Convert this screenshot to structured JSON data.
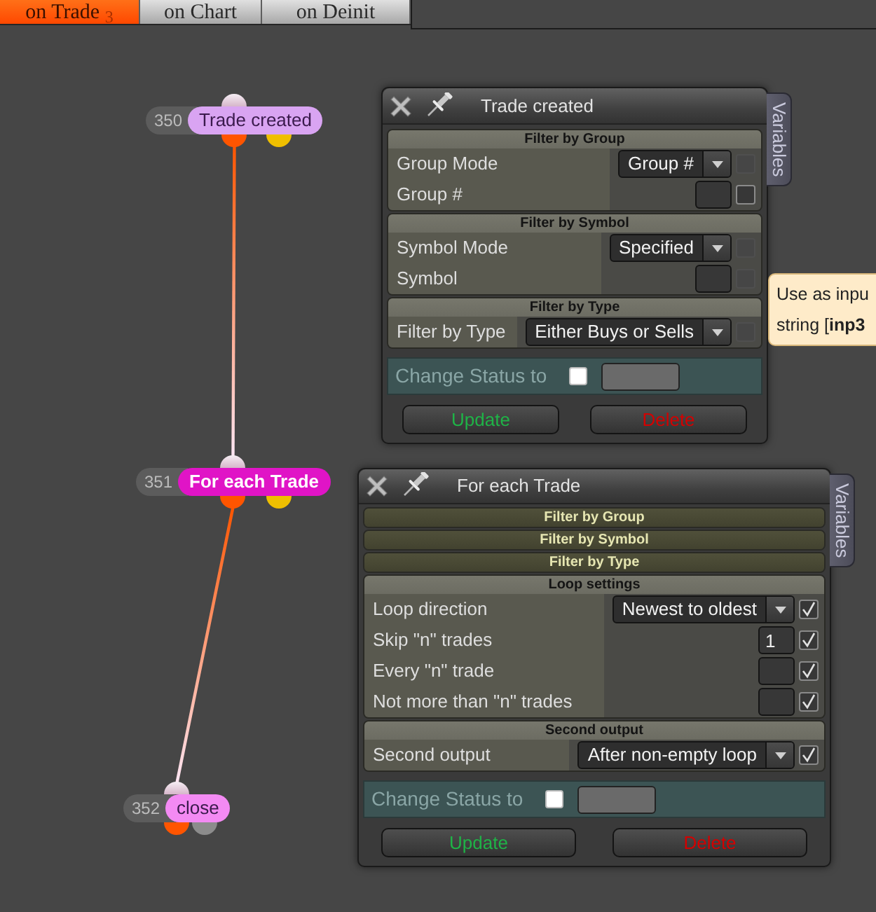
{
  "tabs": [
    {
      "label": "on Trade $_{3}$",
      "selected": true
    },
    {
      "label": "on Chart",
      "selected": false
    },
    {
      "label": "on Deinit",
      "selected": false
    }
  ],
  "nodes": [
    {
      "number": "350",
      "label": "Trade created",
      "color": "#d9a4f2",
      "selected": false,
      "output_connected": true,
      "outputs": [
        {
          "color": "#ff5500"
        },
        {
          "color": "#efbf00"
        }
      ]
    },
    {
      "number": "351",
      "label": "For each Trade",
      "color": "#e014c6",
      "selected": true,
      "output_connected": true,
      "outputs": [
        {
          "color": "#ff5500"
        },
        {
          "color": "#efbf00"
        }
      ]
    },
    {
      "number": "352",
      "label": "close",
      "color": "#f38af3",
      "selected": false,
      "output_connected": false,
      "outputs": [
        {
          "color": "#ff5500"
        },
        {
          "color": "#8c8c8c"
        }
      ]
    }
  ],
  "panels": [
    {
      "title": "Trade created",
      "side_tab": "Variables",
      "sections": [
        {
          "title": "Filter by Group",
          "expanded": true,
          "rows": [
            {
              "label": "Group Mode",
              "kind": "select",
              "value": "Group #",
              "checked": false,
              "disabled": true
            },
            {
              "label": "Group #",
              "kind": "input",
              "checked": false,
              "disabled": false
            }
          ]
        },
        {
          "title": "Filter by Symbol",
          "expanded": true,
          "rows": [
            {
              "label": "Symbol Mode",
              "kind": "select",
              "value": "Specified",
              "checked": false,
              "disabled": true
            },
            {
              "label": "Symbol",
              "kind": "input",
              "checked": false,
              "disabled": true
            }
          ]
        },
        {
          "title": "Filter by Type",
          "expanded": true,
          "rows": [
            {
              "label": "Filter by Type",
              "kind": "select",
              "value": "Either Buys or Sells",
              "checked": false,
              "disabled": true
            }
          ]
        }
      ],
      "status": {
        "label": "Change Status to",
        "checked": false
      },
      "buttons": [
        {
          "label": "Update",
          "kind": "update"
        },
        {
          "label": "Delete",
          "kind": "delete"
        }
      ]
    },
    {
      "title": "For each Trade",
      "side_tab": "Variables",
      "sections": [
        {
          "title": "Filter by Group",
          "expanded": false
        },
        {
          "title": "Filter by Symbol",
          "expanded": false
        },
        {
          "title": "Filter by Type",
          "expanded": false
        },
        {
          "title": "Loop settings",
          "expanded": true,
          "rows": [
            {
              "label": "Loop direction",
              "kind": "select",
              "value": "Newest to oldest",
              "checked": true,
              "disabled": false
            },
            {
              "label": "Skip \"n\" trades",
              "kind": "input",
              "value": "1",
              "checked": true,
              "disabled": false
            },
            {
              "label": "Every \"n\" trade",
              "kind": "input",
              "checked": true,
              "disabled": false
            },
            {
              "label": "Not more than \"n\" trades",
              "kind": "input",
              "checked": true,
              "disabled": false
            }
          ]
        },
        {
          "title": "Second output",
          "expanded": true,
          "rows": [
            {
              "label": "Second output",
              "kind": "select",
              "value": "After non-empty loop",
              "checked": true,
              "disabled": false
            }
          ]
        }
      ],
      "status": {
        "label": "Change Status to",
        "checked": false
      },
      "buttons": [
        {
          "label": "Update",
          "kind": "update"
        },
        {
          "label": "Delete",
          "kind": "delete"
        }
      ]
    }
  ],
  "tooltip": {
    "lines": [
      "Use as inpu",
      "string [**inp3**"
    ]
  }
}
